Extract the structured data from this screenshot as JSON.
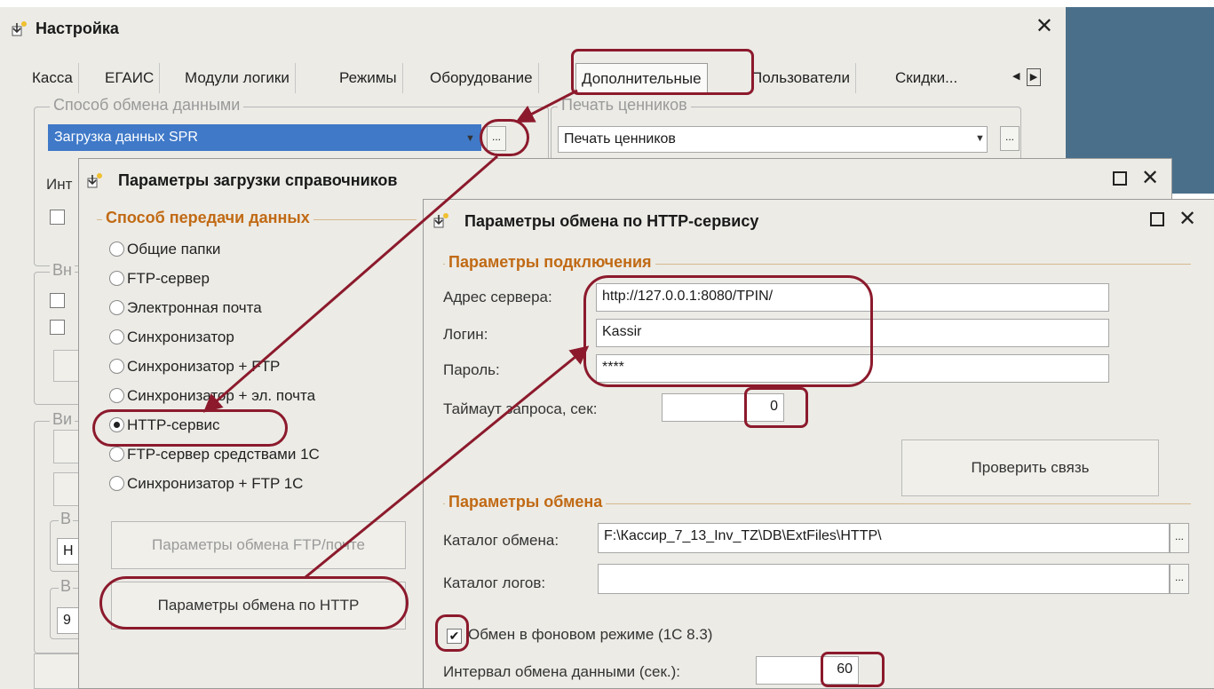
{
  "main_window": {
    "title": "Настройка",
    "tabs": [
      "Касса",
      "ЕГАИС",
      "Модули логики",
      "Режимы",
      "Оборудование",
      "Дополнительные",
      "Пользователи",
      "Скидки..."
    ],
    "active_tab": "Дополнительные",
    "exchange_group_label": "Способ обмена данными",
    "exchange_value": "Загрузка данных SPR",
    "price_group_label": "Печать ценников",
    "price_value": "Печать ценников",
    "dots_label": "...",
    "int_label": "Инт",
    "vn_label": "Вн",
    "vi_label": "Ви",
    "b_label": "В",
    "h_value": "H",
    "nine_value": "9"
  },
  "ref_dialog": {
    "title": "Параметры загрузки справочников",
    "group_label": "Способ передачи данных",
    "options": [
      {
        "label": "Общие папки",
        "selected": false
      },
      {
        "label": "FTP-сервер",
        "selected": false
      },
      {
        "label": "Электронная почта",
        "selected": false
      },
      {
        "label": "Синхронизатор",
        "selected": false
      },
      {
        "label": "Синхронизатор + FTP",
        "selected": false
      },
      {
        "label": "Синхронизатор + эл. почта",
        "selected": false
      },
      {
        "label": "HTTP-сервис",
        "selected": true
      },
      {
        "label": "FTP-сервер средствами 1С",
        "selected": false
      },
      {
        "label": "Синхронизатор + FTP 1С",
        "selected": false
      }
    ],
    "ftp_mail_button": "Параметры обмена FTP/почте",
    "http_button": "Параметры обмена по HTTP"
  },
  "http_dialog": {
    "title": "Параметры обмена по HTTP-сервису",
    "connection_group": "Параметры подключения",
    "server_label": "Адрес сервера:",
    "server_value": "http://127.0.0.1:8080/TPIN/",
    "login_label": "Логин:",
    "login_value": "Kassir",
    "password_label": "Пароль:",
    "password_value": "****",
    "timeout_label": "Таймаут запроса, сек:",
    "timeout_value": "0",
    "check_button": "Проверить связь",
    "exchange_group": "Параметры обмена",
    "catalog_label": "Каталог обмена:",
    "catalog_value": "F:\\Кассир_7_13_Inv_TZ\\DB\\ExtFiles\\HTTP\\",
    "logs_label": "Каталог логов:",
    "logs_value": "",
    "background_label": "Обмен в фоновом режиме (1С 8.3)",
    "background_checked": true,
    "interval_label": "Интервал обмена данными (сек.):",
    "interval_value": "60"
  },
  "colors": {
    "annotation": "#8c1a2c",
    "side_panel": "#4a6f8a",
    "group_orange": "#c16a14",
    "selection": "#3f79c8"
  }
}
